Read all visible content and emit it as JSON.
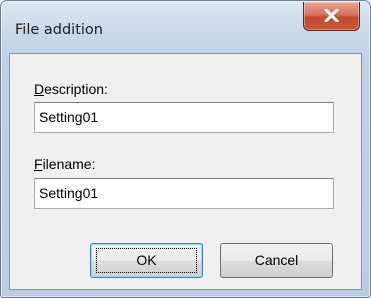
{
  "window": {
    "title": "File addition"
  },
  "icons": {
    "close": "close-icon"
  },
  "form": {
    "description_label_hotkey": "D",
    "description_label_rest": "escription:",
    "description_value": "Setting01",
    "filename_label_hotkey": "F",
    "filename_label_rest": "ilename:",
    "filename_value": "Setting01"
  },
  "buttons": {
    "ok": "OK",
    "cancel": "Cancel"
  },
  "colors": {
    "close_button": "#c85a3d",
    "default_button_border": "#3c7fb1"
  }
}
